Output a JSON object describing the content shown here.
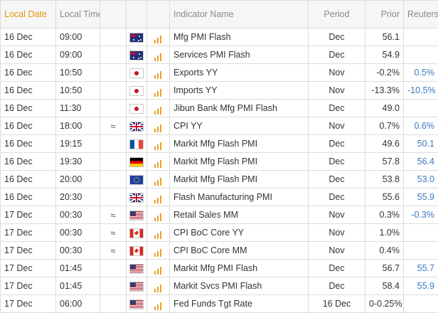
{
  "header": {
    "local_date": "Local Date",
    "local_time": "Local Time",
    "indicator_name": "Indicator Name",
    "period": "Period",
    "prior": "Prior",
    "reuters_poll": "Reuters Poll"
  },
  "colors": {
    "sorted_header": "#e8940c",
    "importance_bars": "#f0a020",
    "poll_text": "#3b78c4",
    "grid_line": "#dcdcdc"
  },
  "rows": [
    {
      "date": "16 Dec",
      "time": "09:00",
      "approx": "",
      "flag": "australia-flag-icon",
      "indicator": "Mfg PMI Flash",
      "period": "Dec",
      "prior": "56.1",
      "poll": ""
    },
    {
      "date": "16 Dec",
      "time": "09:00",
      "approx": "",
      "flag": "australia-flag-icon",
      "indicator": "Services PMI Flash",
      "period": "Dec",
      "prior": "54.9",
      "poll": ""
    },
    {
      "date": "16 Dec",
      "time": "10:50",
      "approx": "",
      "flag": "japan-flag-icon",
      "indicator": "Exports YY",
      "period": "Nov",
      "prior": "-0.2%",
      "poll": "0.5%"
    },
    {
      "date": "16 Dec",
      "time": "10:50",
      "approx": "",
      "flag": "japan-flag-icon",
      "indicator": "Imports YY",
      "period": "Nov",
      "prior": "-13.3%",
      "poll": "-10.5%"
    },
    {
      "date": "16 Dec",
      "time": "11:30",
      "approx": "",
      "flag": "japan-flag-icon",
      "indicator": "Jibun Bank Mfg PMI Flash",
      "period": "Dec",
      "prior": "49.0",
      "poll": ""
    },
    {
      "date": "16 Dec",
      "time": "18:00",
      "approx": "≈",
      "flag": "uk-flag-icon",
      "indicator": "CPI YY",
      "period": "Nov",
      "prior": "0.7%",
      "poll": "0.6%"
    },
    {
      "date": "16 Dec",
      "time": "19:15",
      "approx": "",
      "flag": "france-flag-icon",
      "indicator": "Markit Mfg Flash PMI",
      "period": "Dec",
      "prior": "49.6",
      "poll": "50.1"
    },
    {
      "date": "16 Dec",
      "time": "19:30",
      "approx": "",
      "flag": "germany-flag-icon",
      "indicator": "Markit Mfg Flash PMI",
      "period": "Dec",
      "prior": "57.8",
      "poll": "56.4"
    },
    {
      "date": "16 Dec",
      "time": "20:00",
      "approx": "",
      "flag": "eu-flag-icon",
      "indicator": "Markit Mfg Flash PMI",
      "period": "Dec",
      "prior": "53.8",
      "poll": "53.0"
    },
    {
      "date": "16 Dec",
      "time": "20:30",
      "approx": "",
      "flag": "uk-flag-icon",
      "indicator": "Flash Manufacturing PMI",
      "period": "Dec",
      "prior": "55.6",
      "poll": "55.9"
    },
    {
      "date": "17 Dec",
      "time": "00:30",
      "approx": "≈",
      "flag": "us-flag-icon",
      "indicator": "Retail Sales MM",
      "period": "Nov",
      "prior": "0.3%",
      "poll": "-0.3%"
    },
    {
      "date": "17 Dec",
      "time": "00:30",
      "approx": "≈",
      "flag": "canada-flag-icon",
      "indicator": "CPI BoC Core YY",
      "period": "Nov",
      "prior": "1.0%",
      "poll": ""
    },
    {
      "date": "17 Dec",
      "time": "00:30",
      "approx": "≈",
      "flag": "canada-flag-icon",
      "indicator": "CPI BoC Core MM",
      "period": "Nov",
      "prior": "0.4%",
      "poll": ""
    },
    {
      "date": "17 Dec",
      "time": "01:45",
      "approx": "",
      "flag": "us-flag-icon",
      "indicator": "Markit Mfg PMI Flash",
      "period": "Dec",
      "prior": "56.7",
      "poll": "55.7"
    },
    {
      "date": "17 Dec",
      "time": "01:45",
      "approx": "",
      "flag": "us-flag-icon",
      "indicator": "Markit Svcs PMI Flash",
      "period": "Dec",
      "prior": "58.4",
      "poll": "55.9"
    },
    {
      "date": "17 Dec",
      "time": "06:00",
      "approx": "",
      "flag": "us-flag-icon",
      "indicator": "Fed Funds Tgt Rate",
      "period": "16 Dec",
      "prior": "0-0.25%",
      "poll": ""
    }
  ]
}
